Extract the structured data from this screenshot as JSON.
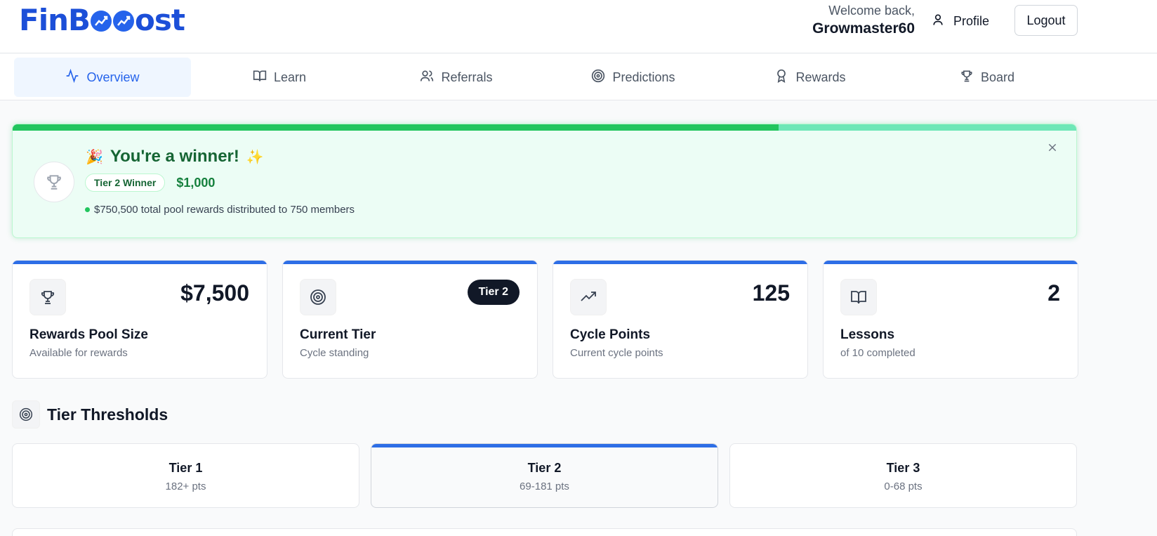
{
  "header": {
    "logo_prefix": "FinB",
    "logo_suffix": "ost",
    "welcome_line": "Welcome back,",
    "username": "Growmaster60",
    "profile_label": "Profile",
    "logout_label": "Logout"
  },
  "nav": {
    "tabs": [
      {
        "label": "Overview",
        "icon": "activity-icon",
        "active": true
      },
      {
        "label": "Learn",
        "icon": "book-icon",
        "active": false
      },
      {
        "label": "Referrals",
        "icon": "users-icon",
        "active": false
      },
      {
        "label": "Predictions",
        "icon": "target-icon",
        "active": false
      },
      {
        "label": "Rewards",
        "icon": "award-icon",
        "active": false
      },
      {
        "label": "Board",
        "icon": "trophy-icon",
        "active": false
      }
    ]
  },
  "banner": {
    "progress": 0.72,
    "emoji_start": "🎉",
    "title": "You're a winner!",
    "emoji_end": "✨",
    "tier_badge": "Tier 2 Winner",
    "amount": "$1,000",
    "note": "$750,500 total pool rewards distributed to 750 members"
  },
  "stats": [
    {
      "value": "$7,500",
      "label": "Rewards Pool Size",
      "sub": "Available for rewards",
      "icon": "trophy-icon"
    },
    {
      "pill": "Tier 2",
      "label": "Current Tier",
      "sub": "Cycle standing",
      "icon": "target-icon"
    },
    {
      "value": "125",
      "label": "Cycle Points",
      "sub": "Current cycle points",
      "icon": "trending-up-icon"
    },
    {
      "value": "2",
      "label": "Lessons",
      "sub": "of 10 completed",
      "icon": "book-icon"
    }
  ],
  "tiers_section": {
    "title": "Tier Thresholds",
    "tiers": [
      {
        "name": "Tier 1",
        "range": "182+ pts",
        "current": false
      },
      {
        "name": "Tier 2",
        "range": "69-181 pts",
        "current": true
      },
      {
        "name": "Tier 3",
        "range": "0-68 pts",
        "current": false
      }
    ]
  },
  "colors": {
    "brand": "#1c4fd8",
    "accent": "#2e6ee6",
    "success": "#22c55e",
    "banner_bg": "#ecfdf5",
    "dark_pill": "#111827"
  }
}
